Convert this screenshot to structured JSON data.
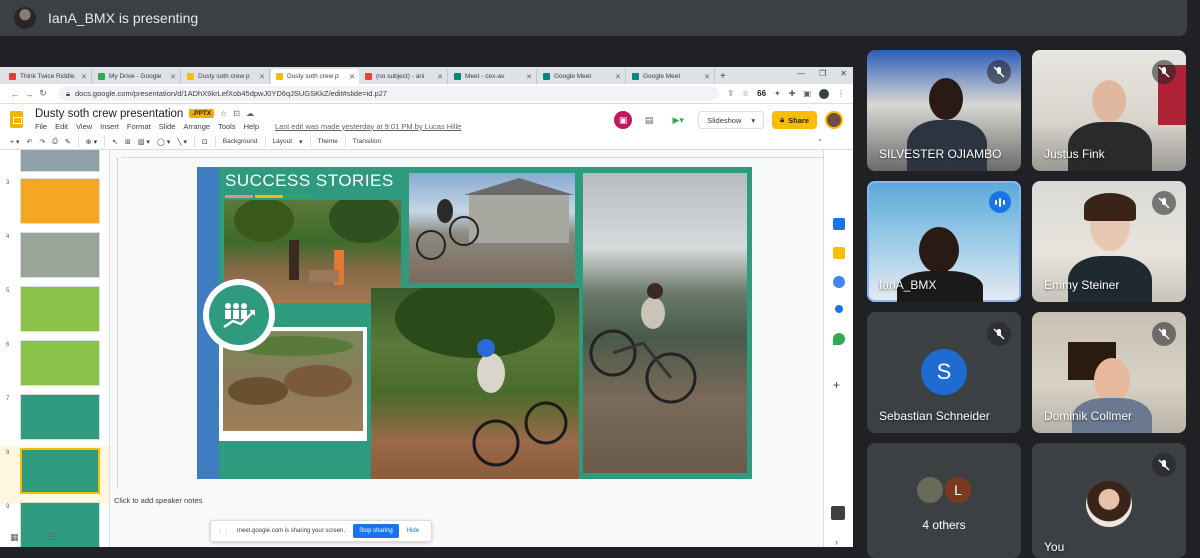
{
  "meet": {
    "presenting_banner": "IanA_BMX is presenting"
  },
  "browser": {
    "tabs": [
      {
        "label": "Think Twice Riddle",
        "favicon_color": "#e53935"
      },
      {
        "label": "My Drive - Google",
        "favicon_color": "#34a853"
      },
      {
        "label": "Dusty soth crew p",
        "favicon_color": "#fbbc04"
      },
      {
        "label": "Dusty soth crew p",
        "favicon_color": "#fbbc04",
        "active": true
      },
      {
        "label": "(no subject) - ani",
        "favicon_color": "#ea4335"
      },
      {
        "label": "Meet - cex-av",
        "favicon_color": "#00897b"
      },
      {
        "label": "Google Meet",
        "favicon_color": "#00897b"
      },
      {
        "label": "Google Meet",
        "favicon_color": "#00897b"
      }
    ],
    "url": "docs.google.com/presentation/d/1ADhX9krLefXob45dpwJ0YD6qJSUGSKkZ/edit#slide=id.p27",
    "extensions_count": "66"
  },
  "slides": {
    "doc_title": "Dusty soth crew presentation",
    "file_badge": ".PPTX",
    "menu": [
      "File",
      "Edit",
      "View",
      "Insert",
      "Format",
      "Slide",
      "Arrange",
      "Tools",
      "Help"
    ],
    "last_edit": "Last edit was made yesterday at 9:01 PM by Lucas Hille",
    "slideshow_label": "Slideshow",
    "share_label": "Share",
    "toolbar": {
      "background": "Background",
      "layout": "Layout",
      "theme": "Theme",
      "transition": "Transition"
    },
    "thumbnails": [
      {
        "num": "",
        "color": "#8fa0a8"
      },
      {
        "num": "3",
        "color": "#f5a623"
      },
      {
        "num": "4",
        "color": "#9aa59a"
      },
      {
        "num": "5",
        "color": "#8bc34a"
      },
      {
        "num": "6",
        "color": "#8bc34a"
      },
      {
        "num": "7",
        "color": "#2e9b7e"
      },
      {
        "num": "8",
        "color": "#2e9b7e",
        "selected": true
      },
      {
        "num": "9",
        "color": "#2e9b7e"
      }
    ],
    "current_slide": {
      "title": "SUCCESS STORIES",
      "underline_colors": [
        "#f28b82",
        "#fbbc04",
        "#34a853"
      ]
    },
    "speaker_notes_placeholder": "Click to add speaker notes",
    "sharing_notice": "meet.google.com is sharing your screen.",
    "stop_sharing": "Stop sharing",
    "hide": "Hide"
  },
  "participants": [
    {
      "name": "SILVESTER OJIAMBO",
      "muted": true,
      "type": "video"
    },
    {
      "name": "Justus Fink",
      "muted": true,
      "type": "video"
    },
    {
      "name": "IanA_BMX",
      "muted": false,
      "speaking": true,
      "type": "video"
    },
    {
      "name": "Emmy Steiner",
      "muted": true,
      "type": "video"
    },
    {
      "name": "Sebastian Schneider",
      "muted": true,
      "type": "avatar",
      "initial": "S"
    },
    {
      "name": "Dominik Collmer",
      "muted": true,
      "type": "video"
    },
    {
      "name": "4 others",
      "type": "others",
      "avatar_initial": "L"
    },
    {
      "name": "You",
      "muted": true,
      "type": "self"
    }
  ],
  "colors": {
    "meet_bg": "#202124",
    "tile_bg": "#3c4043",
    "accent_blue": "#1a73e8",
    "slides_yellow": "#fbbc04",
    "slide_green": "#2e9b7e"
  }
}
